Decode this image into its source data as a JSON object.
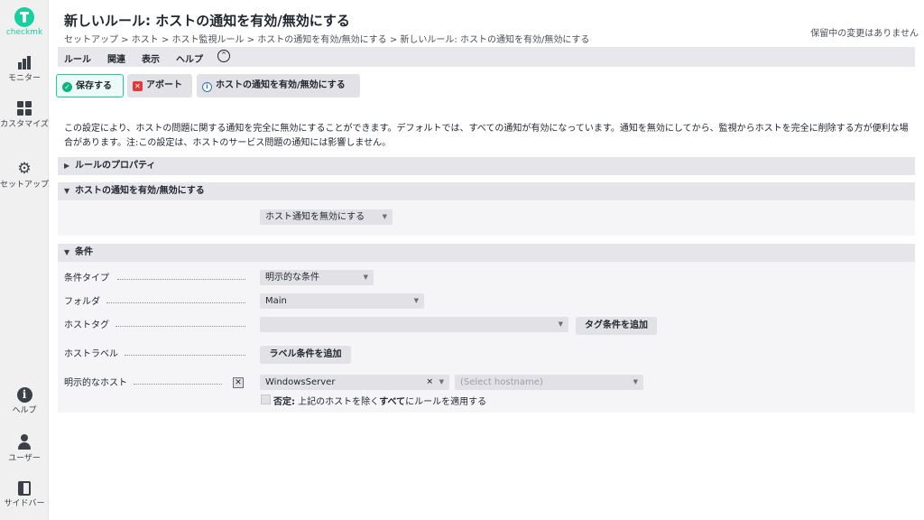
{
  "sidebar": {
    "logo_text": "checkmk",
    "items": [
      {
        "label": "モニター"
      },
      {
        "label": "カスタマイズ"
      },
      {
        "label": "セットアップ"
      },
      {
        "label": "ヘルプ"
      },
      {
        "label": "ユーザー"
      },
      {
        "label": "サイドバー"
      }
    ]
  },
  "header": {
    "title": "新しいルール: ホストの通知を有効/無効にする",
    "breadcrumb": "セットアップ > ホスト > ホスト監視ルール > ホストの通知を有効/無効にする > 新しいルール: ホストの通知を有効/無効にする",
    "pending": "保留中の変更はありません"
  },
  "menubar": {
    "items": [
      "ルール",
      "関連",
      "表示",
      "ヘルプ"
    ],
    "collapse_icon": "chevron-up-icon"
  },
  "toolbar": {
    "save_label": "保存する",
    "abort_label": "アボート",
    "toggle_label": "ホストの通知を有効/無効にする"
  },
  "description": "この設定により、ホストの問題に関する通知を完全に無効にすることができます。デフォルトでは、すべての通知が有効になっています。通知を無効にしてから、監視からホストを完全に削除する方が便利な場合があります。注:この設定は、ホストのサービス問題の通知には影響しません。",
  "sections": {
    "properties": {
      "title": "ルールのプロパティ"
    },
    "value": {
      "title": "ホストの通知を有効/無効にする",
      "select_value": "ホスト通知を無効にする"
    },
    "conditions": {
      "title": "条件",
      "condition_type_label": "条件タイプ",
      "condition_type_value": "明示的な条件",
      "folder_label": "フォルダ",
      "folder_value": "Main",
      "host_tags_label": "ホストタグ",
      "host_tags_value": "",
      "add_tag_condition": "タグ条件を追加",
      "host_labels_label": "ホストラベル",
      "add_label_condition": "ラベル条件を追加",
      "explicit_hosts_label": "明示的なホスト",
      "explicit_host_value": "WindowsServer",
      "hostname_placeholder": "(Select hostname)",
      "negate_bold": "否定:",
      "negate_text_1": " 上記のホストを除く",
      "negate_bold_2": "すべて",
      "negate_text_2": "にルールを適用する"
    }
  },
  "colors": {
    "accent": "#15d1a0",
    "sidebar_bg": "#f0f0f0",
    "section_bg": "#e6e6ea"
  }
}
